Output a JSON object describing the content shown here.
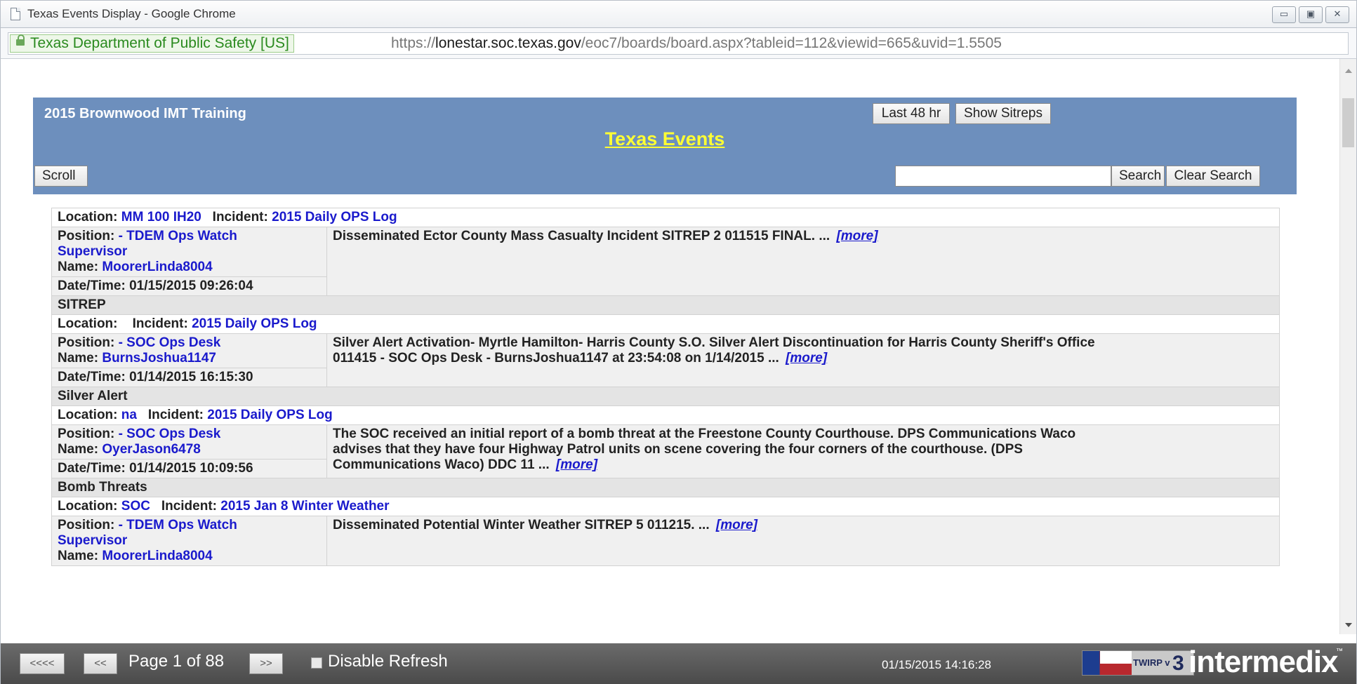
{
  "window": {
    "title": "Texas Events Display - Google Chrome",
    "buttons": {
      "minimize": "▭",
      "maximize": "▣",
      "close": "✕"
    }
  },
  "address": {
    "cert": "Texas Department of Public Safety [US]",
    "url_scheme": "https://",
    "url_host": "lonestar.soc.texas.gov",
    "url_path": "/eoc7/boards/board.aspx?tableid=112&viewid=665&uvid=1.5505"
  },
  "board": {
    "name": "2015 Brownwood IMT Training",
    "title": "Texas Events",
    "last48_label": "Last 48 hr",
    "sitreps_label": "Show Sitreps",
    "scroll_label": "Scroll",
    "search_label": "Search",
    "clear_label": "Clear Search",
    "search_value": ""
  },
  "labels": {
    "location": "Location:",
    "incident": "Incident:",
    "position": "Position:",
    "name": "Name:",
    "datetime": "Date/Time:",
    "more": "[more]"
  },
  "events": [
    {
      "location": "MM 100 IH20",
      "incident": "2015 Daily OPS Log",
      "position_l1": "- TDEM Ops Watch",
      "position_l2": "Supervisor",
      "name": "MoorerLinda8004",
      "datetime": "01/15/2015 09:26:04",
      "description": "Disseminated Ector County Mass Casualty Incident SITREP 2 011515 FINAL. ...",
      "category": "SITREP"
    },
    {
      "location": "",
      "incident": "2015 Daily OPS Log",
      "position_l1": "- SOC Ops Desk",
      "name": "BurnsJoshua1147",
      "datetime": "01/14/2015 16:15:30",
      "description_l1": "Silver Alert Activation- Myrtle Hamilton- Harris County S.O. Silver Alert Discontinuation for Harris County Sheriff's Office",
      "description_l2": "011415 - SOC Ops Desk - BurnsJoshua1147 at 23:54:08 on 1/14/2015 ...",
      "category": "Silver Alert"
    },
    {
      "location": "na",
      "incident": "2015 Daily OPS Log",
      "position_l1": "- SOC Ops Desk",
      "name": "OyerJason6478",
      "datetime": "01/14/2015 10:09:56",
      "description_l1": "The SOC received an initial report of a bomb threat at the Freestone County Courthouse. DPS Communications Waco",
      "description_l2": "advises that they have four Highway Patrol units on scene covering the four corners of the courthouse. (DPS",
      "description_l3": "Communications Waco) DDC 11 ...",
      "category": "Bomb Threats"
    },
    {
      "location": "SOC",
      "incident": "2015 Jan 8 Winter Weather",
      "position_l1": "- TDEM Ops Watch",
      "position_l2": "Supervisor",
      "name": "MoorerLinda8004",
      "description": "Disseminated Potential Winter Weather SITREP 5 011215. ..."
    }
  ],
  "footer": {
    "first_label": "<<<<",
    "prev_label": "<<",
    "page_text": "Page 1 of 88",
    "next_label": ">>",
    "disable_refresh": "Disable Refresh",
    "timestamp": "01/15/2015 14:16:28",
    "badge_text": "TWIRP v",
    "badge_num": "3",
    "brand": "intermedix",
    "brand_tm": "™"
  }
}
